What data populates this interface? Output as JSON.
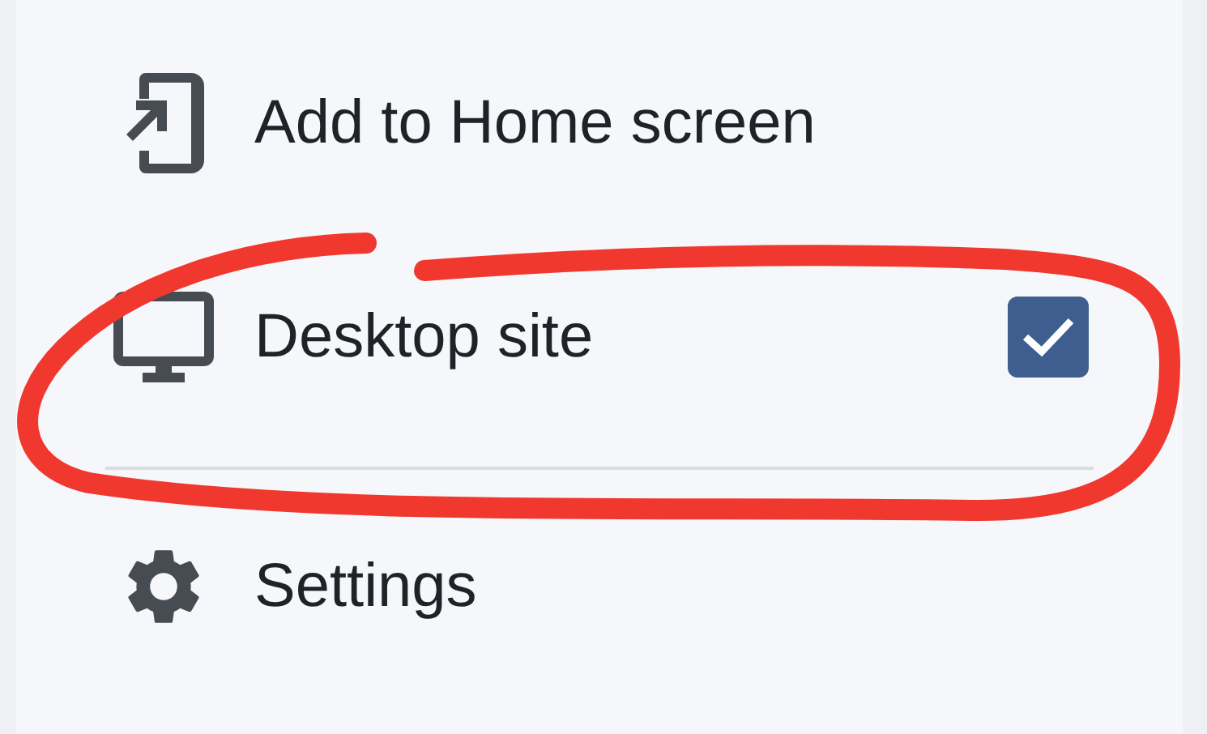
{
  "menu": {
    "items": [
      {
        "kind": "action",
        "label": "Add to Home screen"
      },
      {
        "kind": "checkbox",
        "label": "Desktop site",
        "checked": true
      },
      {
        "kind": "action",
        "label": "Settings"
      }
    ]
  },
  "annotation": {
    "kind": "circle",
    "color": "#f0382e"
  }
}
